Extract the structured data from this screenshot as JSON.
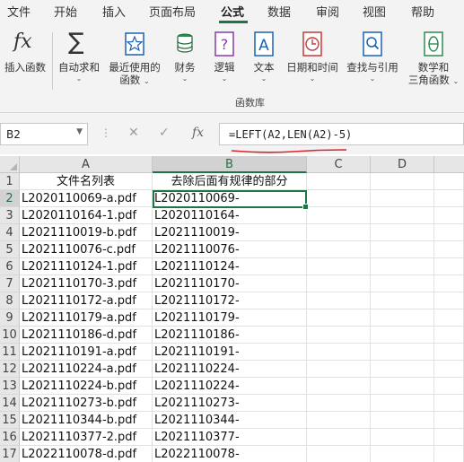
{
  "menu": {
    "tabs": [
      "文件",
      "开始",
      "插入",
      "页面布局",
      "公式",
      "数据",
      "审阅",
      "视图",
      "帮助"
    ],
    "active": "公式"
  },
  "ribbon": {
    "insert_function": "插入函数",
    "autosum": "自动求和",
    "recent_1": "最近使用的",
    "recent_2": "函数",
    "financial": "财务",
    "logical": "逻辑",
    "text": "文本",
    "datetime": "日期和时间",
    "lookup": "查找与引用",
    "math_1": "数学和",
    "math_2": "三角函数",
    "group_label": "函数库",
    "caret": "⌄",
    "fx_glyph": "fx",
    "sigma_glyph": "∑"
  },
  "formula_bar": {
    "name_box": "B2",
    "formula": "=LEFT(A2,LEN(A2)-5)",
    "cancel": "✕",
    "enter": "✓",
    "fx": "fx",
    "dots": "⋮"
  },
  "grid": {
    "columns": [
      "A",
      "B",
      "C",
      "D"
    ],
    "headers": {
      "A": "文件名列表",
      "B": "去除后面有规律的部分"
    },
    "rows": [
      {
        "n": "1"
      },
      {
        "n": "2",
        "a": "L2020110069-a.pdf",
        "b": "L2020110069-"
      },
      {
        "n": "3",
        "a": "L2020110164-1.pdf",
        "b": "L2020110164-"
      },
      {
        "n": "4",
        "a": "L2021110019-b.pdf",
        "b": "L2021110019-"
      },
      {
        "n": "5",
        "a": "L2021110076-c.pdf",
        "b": "L2021110076-"
      },
      {
        "n": "6",
        "a": "L2021110124-1.pdf",
        "b": "L2021110124-"
      },
      {
        "n": "7",
        "a": "L2021110170-3.pdf",
        "b": "L2021110170-"
      },
      {
        "n": "8",
        "a": "L2021110172-a.pdf",
        "b": "L2021110172-"
      },
      {
        "n": "9",
        "a": "L2021110179-a.pdf",
        "b": "L2021110179-"
      },
      {
        "n": "10",
        "a": "L2021110186-d.pdf",
        "b": "L2021110186-"
      },
      {
        "n": "11",
        "a": "L2021110191-a.pdf",
        "b": "L2021110191-"
      },
      {
        "n": "12",
        "a": "L2021110224-a.pdf",
        "b": "L2021110224-"
      },
      {
        "n": "13",
        "a": "L2021110224-b.pdf",
        "b": "L2021110224-"
      },
      {
        "n": "14",
        "a": "L2021110273-b.pdf",
        "b": "L2021110273-"
      },
      {
        "n": "15",
        "a": "L2021110344-b.pdf",
        "b": "L2021110344-"
      },
      {
        "n": "16",
        "a": "L2021110377-2.pdf",
        "b": "L2021110377-"
      },
      {
        "n": "17",
        "a": "L2022110078-d.pdf",
        "b": "L2022110078-"
      }
    ]
  },
  "colors": {
    "accent": "#217346",
    "annotation": "#d9262c"
  }
}
